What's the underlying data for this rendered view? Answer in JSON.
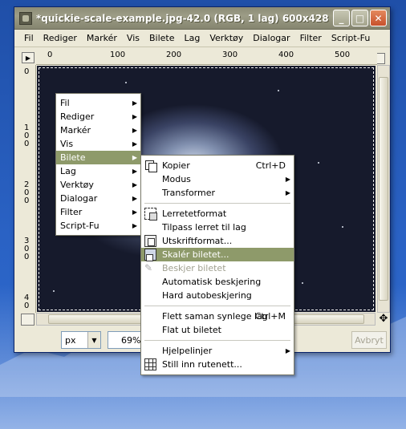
{
  "window": {
    "title": "*quickie-scale-example.jpg-42.0 (RGB, 1 lag) 600x428",
    "min_glyph": "_",
    "max_glyph": "□",
    "close_glyph": "✕"
  },
  "menubar": [
    "Fil",
    "Rediger",
    "Markér",
    "Vis",
    "Bilete",
    "Lag",
    "Verktøy",
    "Dialogar",
    "Filter",
    "Script-Fu"
  ],
  "ruler": {
    "h_labels": [
      "0",
      "100",
      "200",
      "300",
      "400",
      "500"
    ],
    "v_labels": [
      "0",
      "1\n0\n0",
      "2\n0\n0",
      "3\n0\n0",
      "4\n0"
    ]
  },
  "statusbar": {
    "unit": "px",
    "zoom": "69%",
    "cancel_label": "Avbryt"
  },
  "context_menu": {
    "items": [
      "Fil",
      "Rediger",
      "Markér",
      "Vis",
      "Bilete",
      "Lag",
      "Verktøy",
      "Dialogar",
      "Filter",
      "Script-Fu"
    ],
    "active_index": 4
  },
  "image_menu": {
    "groups": [
      [
        {
          "label": "Kopier",
          "accel": "Ctrl+D",
          "icon": "duplicate-icon"
        },
        {
          "label": "Modus",
          "submenu": true
        },
        {
          "label": "Transformer",
          "submenu": true
        }
      ],
      [
        {
          "label": "Lerretetformat",
          "icon": "canvas-size-icon"
        },
        {
          "label": "Tilpass lerret til lag"
        },
        {
          "label": "Utskriftformat...",
          "icon": "print-size-icon"
        },
        {
          "label": "Skalér biletet...",
          "icon": "scale-image-icon",
          "active": true
        },
        {
          "label": "Beskjer biletet",
          "icon": "crop-icon",
          "disabled": true
        },
        {
          "label": "Automatisk beskjering"
        },
        {
          "label": "Hard autobeskjering"
        }
      ],
      [
        {
          "label": "Flett saman synlege lag",
          "accel": "Ctrl+M"
        },
        {
          "label": "Flat ut biletet"
        }
      ],
      [
        {
          "label": "Hjelpelinjer",
          "submenu": true
        },
        {
          "label": "Still inn rutenett...",
          "icon": "grid-icon"
        }
      ]
    ]
  },
  "colors": {
    "menu_highlight": "#8e9a6a",
    "titlebar": "#9c9c86",
    "desktop": "#2a62c4"
  }
}
